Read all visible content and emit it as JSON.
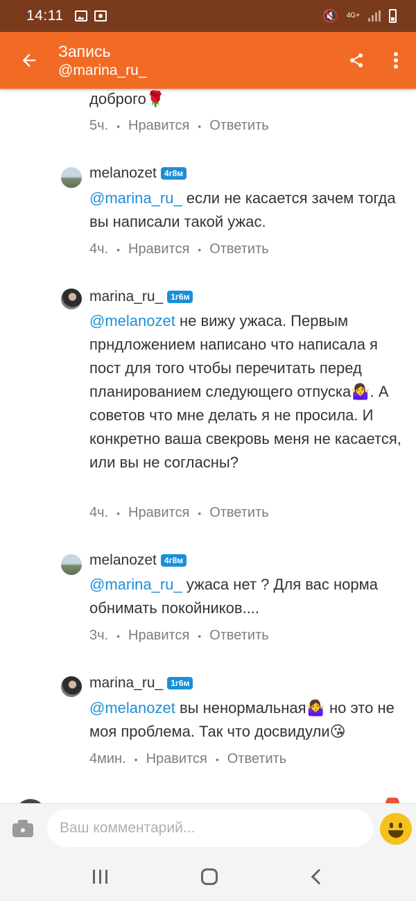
{
  "status_bar": {
    "time": "14:11",
    "network_label": "4G+",
    "icons": [
      "gallery-icon",
      "screen-record-icon",
      "mute-icon",
      "signal-icon",
      "battery-icon"
    ]
  },
  "app_bar": {
    "title": "Запись",
    "subtitle": "@marina_ru_",
    "icons": [
      "back-arrow-icon",
      "share-icon",
      "more-vert-icon"
    ],
    "color": "#f26b25"
  },
  "feed": {
    "partial_comment": {
      "text_tail": "доброго🌹",
      "time": "5ч.",
      "like_label": "Нравится",
      "reply_label": "Ответить"
    },
    "comments": [
      {
        "author": "melanozet",
        "badge": "4г8м",
        "mention": "@marina_ru_",
        "text": " если не касается зачем тогда вы написали такой ужас.",
        "time": "4ч.",
        "like_label": "Нравится",
        "reply_label": "Ответить"
      },
      {
        "author": "marina_ru_",
        "badge": "1г6м",
        "mention": "@melanozet",
        "text": " не вижу ужаса. Первым прндложением написано что написала я пост для того чтобы перечитать перед планированием следующего отпуска🤷‍♀️. А советов что мне делать я не просила. И конкретно ваша свекровь меня не касается, или вы не согласны?",
        "time": "4ч.",
        "like_label": "Нравится",
        "reply_label": "Ответить"
      },
      {
        "author": "melanozet",
        "badge": "4г8м",
        "mention": "@marina_ru_",
        "text": " ужаса нет ? Для вас норма обнимать покойников....",
        "time": "3ч.",
        "like_label": "Нравится",
        "reply_label": "Ответить"
      },
      {
        "author": "marina_ru_",
        "badge": "1г6м",
        "mention": "@melanozet",
        "text": " вы ненормальная🤷‍♀️ но это не моя проблема. Так что досвидули😘",
        "time": "4мин.",
        "like_label": "Нравится",
        "reply_label": "Ответить"
      }
    ]
  },
  "comment_bar": {
    "placeholder": "Ваш комментарий..."
  },
  "nav_bar": {
    "icons": [
      "recents-icon",
      "home-icon",
      "back-icon"
    ]
  }
}
